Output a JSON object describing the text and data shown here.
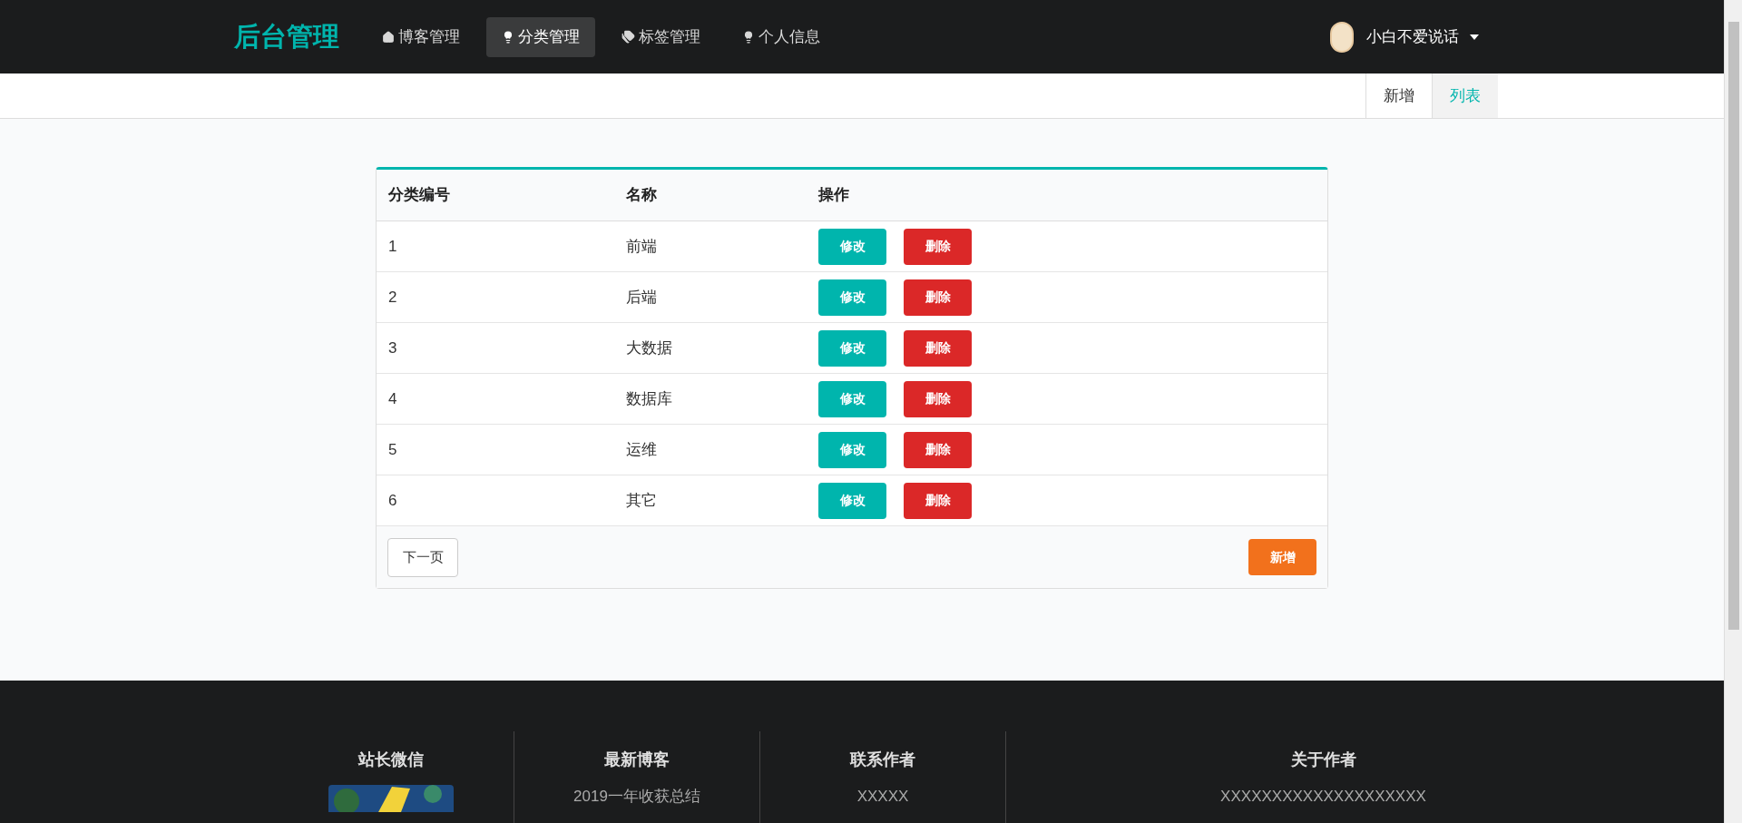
{
  "nav": {
    "logo": "后台管理",
    "items": [
      {
        "label": "博客管理",
        "kind": "home",
        "selected": false
      },
      {
        "label": "分类管理",
        "kind": "bulb",
        "selected": true
      },
      {
        "label": "标签管理",
        "kind": "tags",
        "selected": false
      },
      {
        "label": "个人信息",
        "kind": "bulb",
        "selected": false
      }
    ],
    "user": {
      "name": "小白不爱说话"
    }
  },
  "subtabs": [
    {
      "label": "新增",
      "selected": false
    },
    {
      "label": "列表",
      "selected": true
    }
  ],
  "table": {
    "columns": [
      "分类编号",
      "名称",
      "操作"
    ],
    "rows": [
      {
        "id": "1",
        "name": "前端",
        "actions": [
          {
            "label": "修改",
            "kind": "edit"
          },
          {
            "label": "删除",
            "kind": "delete"
          }
        ]
      },
      {
        "id": "2",
        "name": "后端",
        "actions": [
          {
            "label": "修改",
            "kind": "edit"
          },
          {
            "label": "删除",
            "kind": "delete"
          }
        ]
      },
      {
        "id": "3",
        "name": "大数据",
        "actions": [
          {
            "label": "修改",
            "kind": "edit"
          },
          {
            "label": "删除",
            "kind": "delete"
          }
        ]
      },
      {
        "id": "4",
        "name": "数据库",
        "actions": [
          {
            "label": "修改",
            "kind": "edit"
          },
          {
            "label": "删除",
            "kind": "delete"
          }
        ]
      },
      {
        "id": "5",
        "name": "运维",
        "actions": [
          {
            "label": "修改",
            "kind": "edit"
          },
          {
            "label": "删除",
            "kind": "delete"
          }
        ]
      },
      {
        "id": "6",
        "name": "其它",
        "actions": [
          {
            "label": "修改",
            "kind": "edit"
          },
          {
            "label": "删除",
            "kind": "delete"
          }
        ]
      }
    ],
    "next_page": "下一页",
    "add": "新增"
  },
  "footer": {
    "columns": [
      {
        "title": "站长微信",
        "kind": "picture"
      },
      {
        "title": "最新博客",
        "kind": "text",
        "text": "2019一年收获总结"
      },
      {
        "title": "联系作者",
        "kind": "text",
        "text": "XXXXX"
      },
      {
        "title": "关于作者",
        "kind": "text",
        "text": "XXXXXXXXXXXXXXXXXXXX"
      }
    ]
  }
}
